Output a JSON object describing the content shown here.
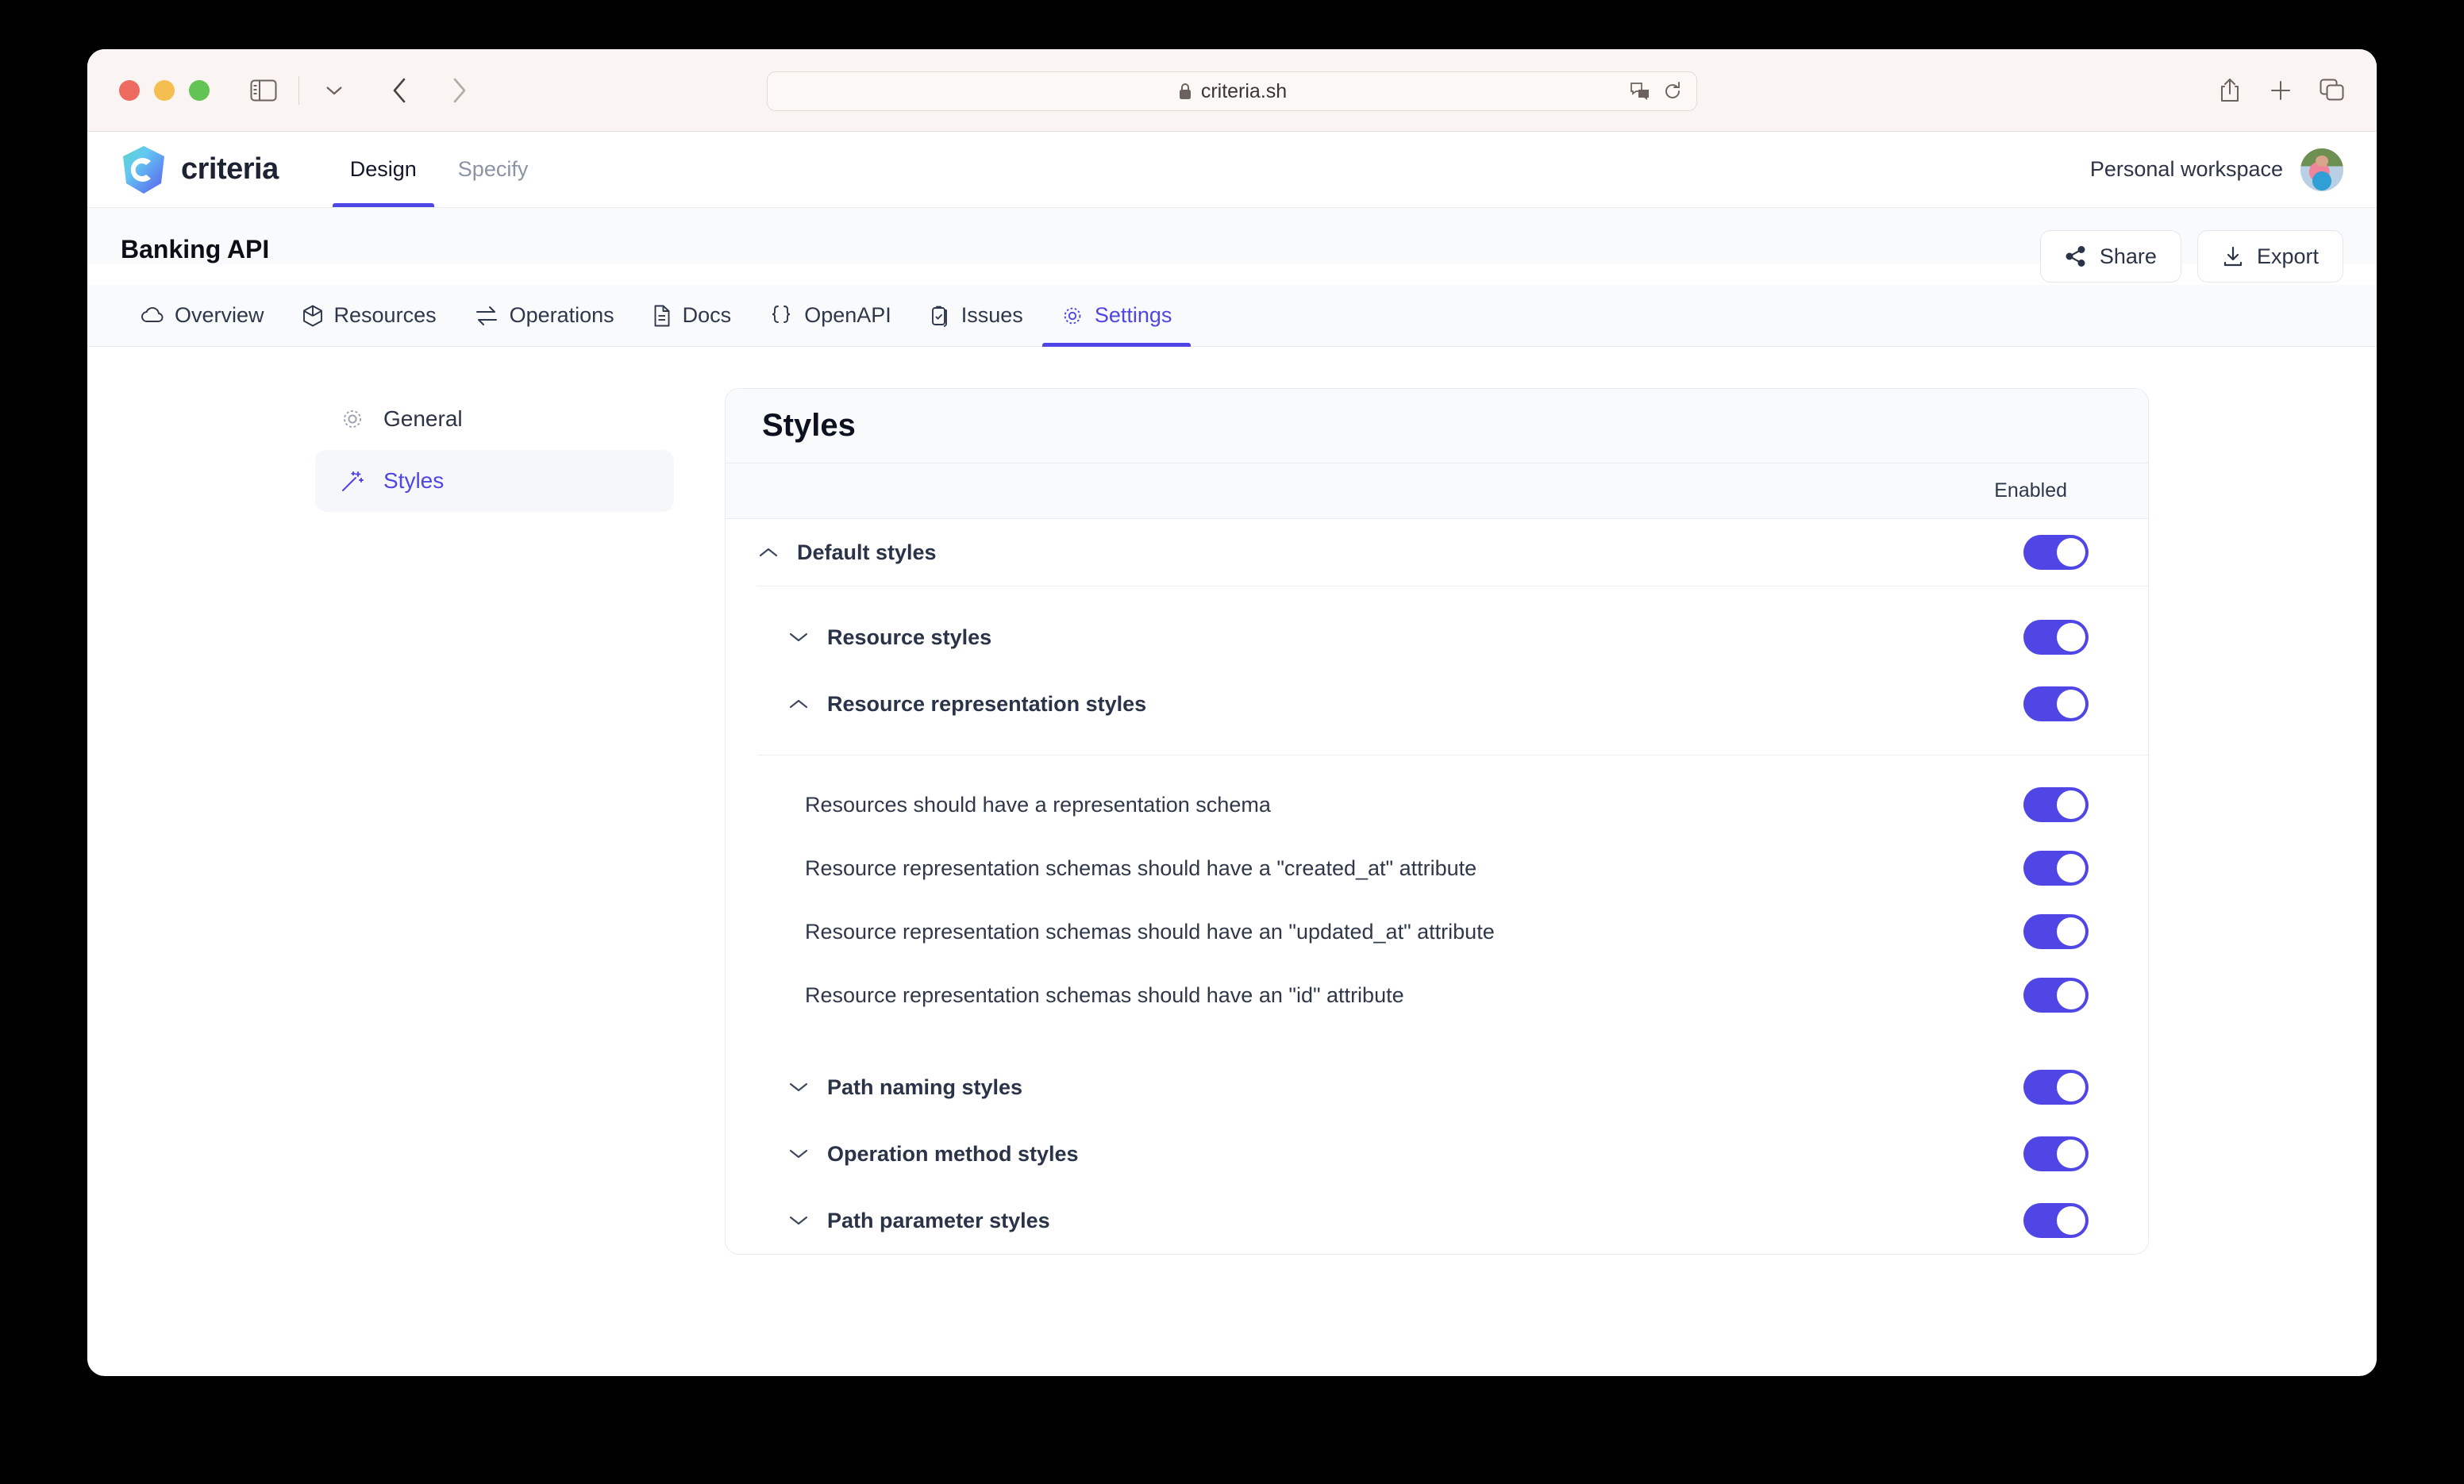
{
  "browser": {
    "url": "criteria.sh",
    "lock_icon": "lock-icon",
    "translate_icon": "translate-icon",
    "reload_icon": "reload-icon",
    "sidebar_icon": "sidebar-toggle-icon",
    "chevron_icon": "chevron-down-icon",
    "back_icon": "back-arrow-icon",
    "forward_icon": "forward-arrow-icon",
    "share_icon": "share-upload-icon",
    "new_tab_icon": "plus-icon",
    "tabs_icon": "tab-overview-icon"
  },
  "app_header": {
    "brand": "criteria",
    "logo_icon": "criteria-logo-icon",
    "nav": [
      {
        "label": "Design",
        "active": true
      },
      {
        "label": "Specify",
        "active": false
      }
    ],
    "workspace": "Personal workspace",
    "avatar_icon": "user-avatar"
  },
  "project": {
    "title": "Banking API",
    "actions": [
      {
        "label": "Share",
        "icon": "share-nodes-icon"
      },
      {
        "label": "Export",
        "icon": "download-icon"
      }
    ],
    "tabs": [
      {
        "label": "Overview",
        "icon": "cloud-icon",
        "active": false
      },
      {
        "label": "Resources",
        "icon": "cube-icon",
        "active": false
      },
      {
        "label": "Operations",
        "icon": "arrows-exchange-icon",
        "active": false
      },
      {
        "label": "Docs",
        "icon": "document-icon",
        "active": false
      },
      {
        "label": "OpenAPI",
        "icon": "curly-braces-icon",
        "active": false
      },
      {
        "label": "Issues",
        "icon": "clipboard-check-icon",
        "active": false
      },
      {
        "label": "Settings",
        "icon": "gear-icon",
        "active": true
      }
    ]
  },
  "settings_nav": [
    {
      "label": "General",
      "icon": "gear-icon",
      "active": false
    },
    {
      "label": "Styles",
      "icon": "magic-wand-icon",
      "active": true
    }
  ],
  "styles_panel": {
    "title": "Styles",
    "column_header_enabled": "Enabled",
    "rows": [
      {
        "label": "Default styles",
        "level": 0,
        "bold": true,
        "expanded": true,
        "chevron": "chevron-up-icon",
        "enabled": true
      },
      {
        "label": "Resource styles",
        "level": 1,
        "bold": true,
        "expanded": false,
        "chevron": "chevron-down-icon",
        "enabled": true
      },
      {
        "label": "Resource representation styles",
        "level": 1,
        "bold": true,
        "expanded": true,
        "chevron": "chevron-up-icon",
        "enabled": true
      },
      {
        "label": "Resources should have a representation schema",
        "level": 2,
        "bold": false,
        "expanded": null,
        "chevron": "",
        "enabled": true
      },
      {
        "label": "Resource representation schemas should have a \"created_at\" attribute",
        "level": 2,
        "bold": false,
        "expanded": null,
        "chevron": "",
        "enabled": true
      },
      {
        "label": "Resource representation schemas should have an \"updated_at\" attribute",
        "level": 2,
        "bold": false,
        "expanded": null,
        "chevron": "",
        "enabled": true
      },
      {
        "label": "Resource representation schemas should have an \"id\" attribute",
        "level": 2,
        "bold": false,
        "expanded": null,
        "chevron": "",
        "enabled": true
      },
      {
        "label": "Path naming styles",
        "level": 1,
        "bold": true,
        "expanded": false,
        "chevron": "chevron-down-icon",
        "enabled": true
      },
      {
        "label": "Operation method styles",
        "level": 1,
        "bold": true,
        "expanded": false,
        "chevron": "chevron-down-icon",
        "enabled": true
      },
      {
        "label": "Path parameter styles",
        "level": 1,
        "bold": true,
        "expanded": false,
        "chevron": "chevron-down-icon",
        "enabled": true
      }
    ]
  },
  "colors": {
    "accent": "#4f46e5",
    "toggle_on": "#4f46e5",
    "page_bg": "#ffffff",
    "panel_bg": "#f8fafc",
    "browser_chrome": "#faf5f2",
    "text": "#2f384b"
  }
}
